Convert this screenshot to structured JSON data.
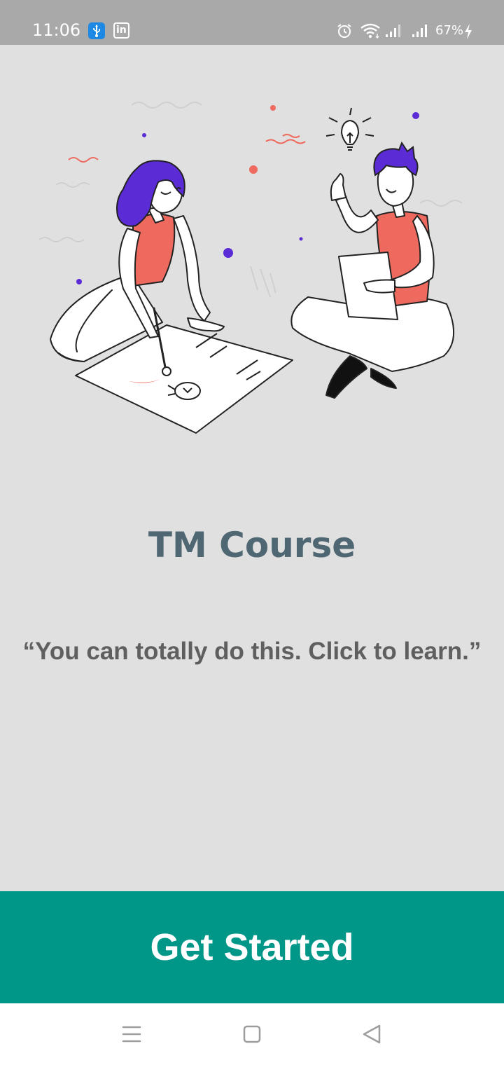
{
  "status_bar": {
    "time": "11:06",
    "battery": "67%",
    "icons": [
      "usb-icon",
      "linkedin-icon",
      "alarm-icon",
      "wifi-icon",
      "signal-icon",
      "signal-icon",
      "charging-bolt-icon"
    ],
    "linkedin_label": "in"
  },
  "main": {
    "title": "TM Course",
    "tagline": "“You can totally do this. Click to learn.”"
  },
  "cta": {
    "label": "Get Started"
  },
  "nav_bar": {
    "icons": [
      "recents-icon",
      "home-icon",
      "back-icon"
    ]
  },
  "colors": {
    "status_bar": "#a9a9a9",
    "background": "#e0e0e0",
    "title": "#4f6772",
    "tagline": "#5f5f5f",
    "accent": "#009688",
    "illustration_coral": "#ef6a5e",
    "illustration_purple": "#5b2bd6"
  }
}
